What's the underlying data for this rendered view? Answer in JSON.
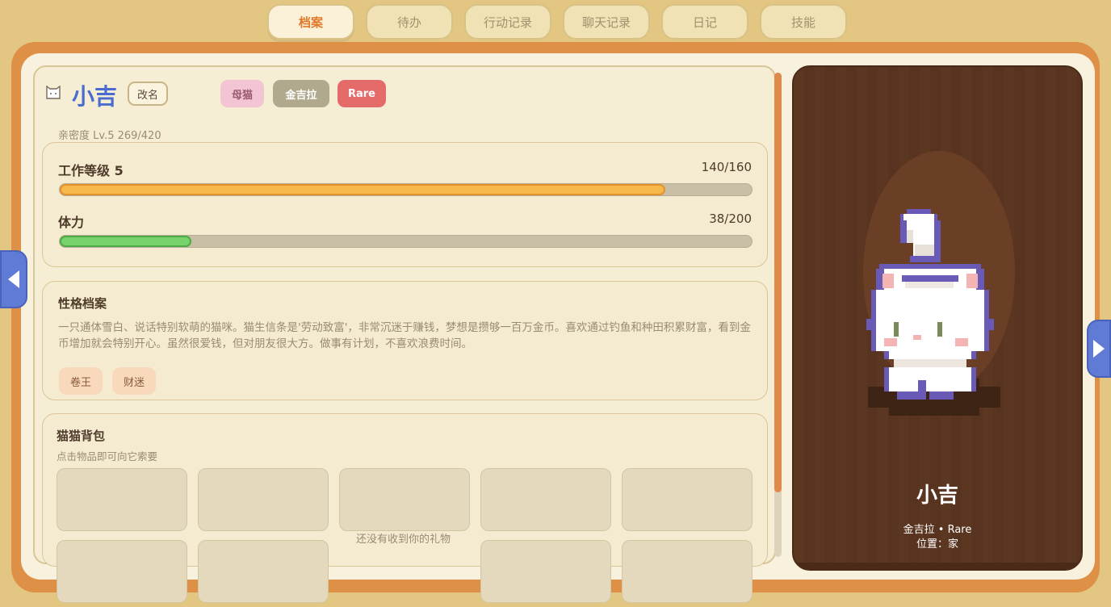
{
  "tabs": [
    {
      "label": "档案",
      "active": true
    },
    {
      "label": "待办",
      "active": false
    },
    {
      "label": "行动记录",
      "active": false
    },
    {
      "label": "聊天记录",
      "active": false
    },
    {
      "label": "日记",
      "active": false
    },
    {
      "label": "技能",
      "active": false
    }
  ],
  "profile": {
    "name": "小吉",
    "rename_label": "改名",
    "tags": {
      "gender": "母猫",
      "breed": "金吉拉",
      "rarity": "Rare"
    },
    "affinity": "亲密度 Lv.5  269/420"
  },
  "stats": {
    "work": {
      "label": "工作等级 5",
      "value_text": "140/160",
      "fraction": 0.875
    },
    "stamina": {
      "label": "体力",
      "value_text": "38/200",
      "fraction": 0.19
    }
  },
  "personality": {
    "title": "性格档案",
    "text": "一只通体雪白、说话特别软萌的猫咪。猫生信条是'劳动致富'，非常沉迷于赚钱，梦想是攒够一百万金币。喜欢通过钓鱼和种田积累财富，看到金币增加就会特别开心。虽然很爱钱，但对朋友很大方。做事有计划，不喜欢浪费时间。",
    "traits": [
      "卷王",
      "财迷"
    ]
  },
  "bag": {
    "title": "猫猫背包",
    "subtitle": "点击物品即可向它索要",
    "empty_message": "还没有收到你的礼物"
  },
  "portrait": {
    "name": "小吉",
    "meta": "金吉拉 • Rare",
    "location": "位置：家"
  },
  "colors": {
    "accent": "#e07a2a",
    "name_blue": "#4a6cd0",
    "frame_orange": "#dd9046",
    "work_bar": "#f6b84c",
    "stamina_bar": "#79d36c",
    "rare": "#e56a6a",
    "portrait_bg": "#5a3520"
  },
  "icons": {
    "profile_icon": "cat-face-icon",
    "nav_prev": "triangle-left-icon",
    "nav_next": "triangle-right-icon"
  }
}
